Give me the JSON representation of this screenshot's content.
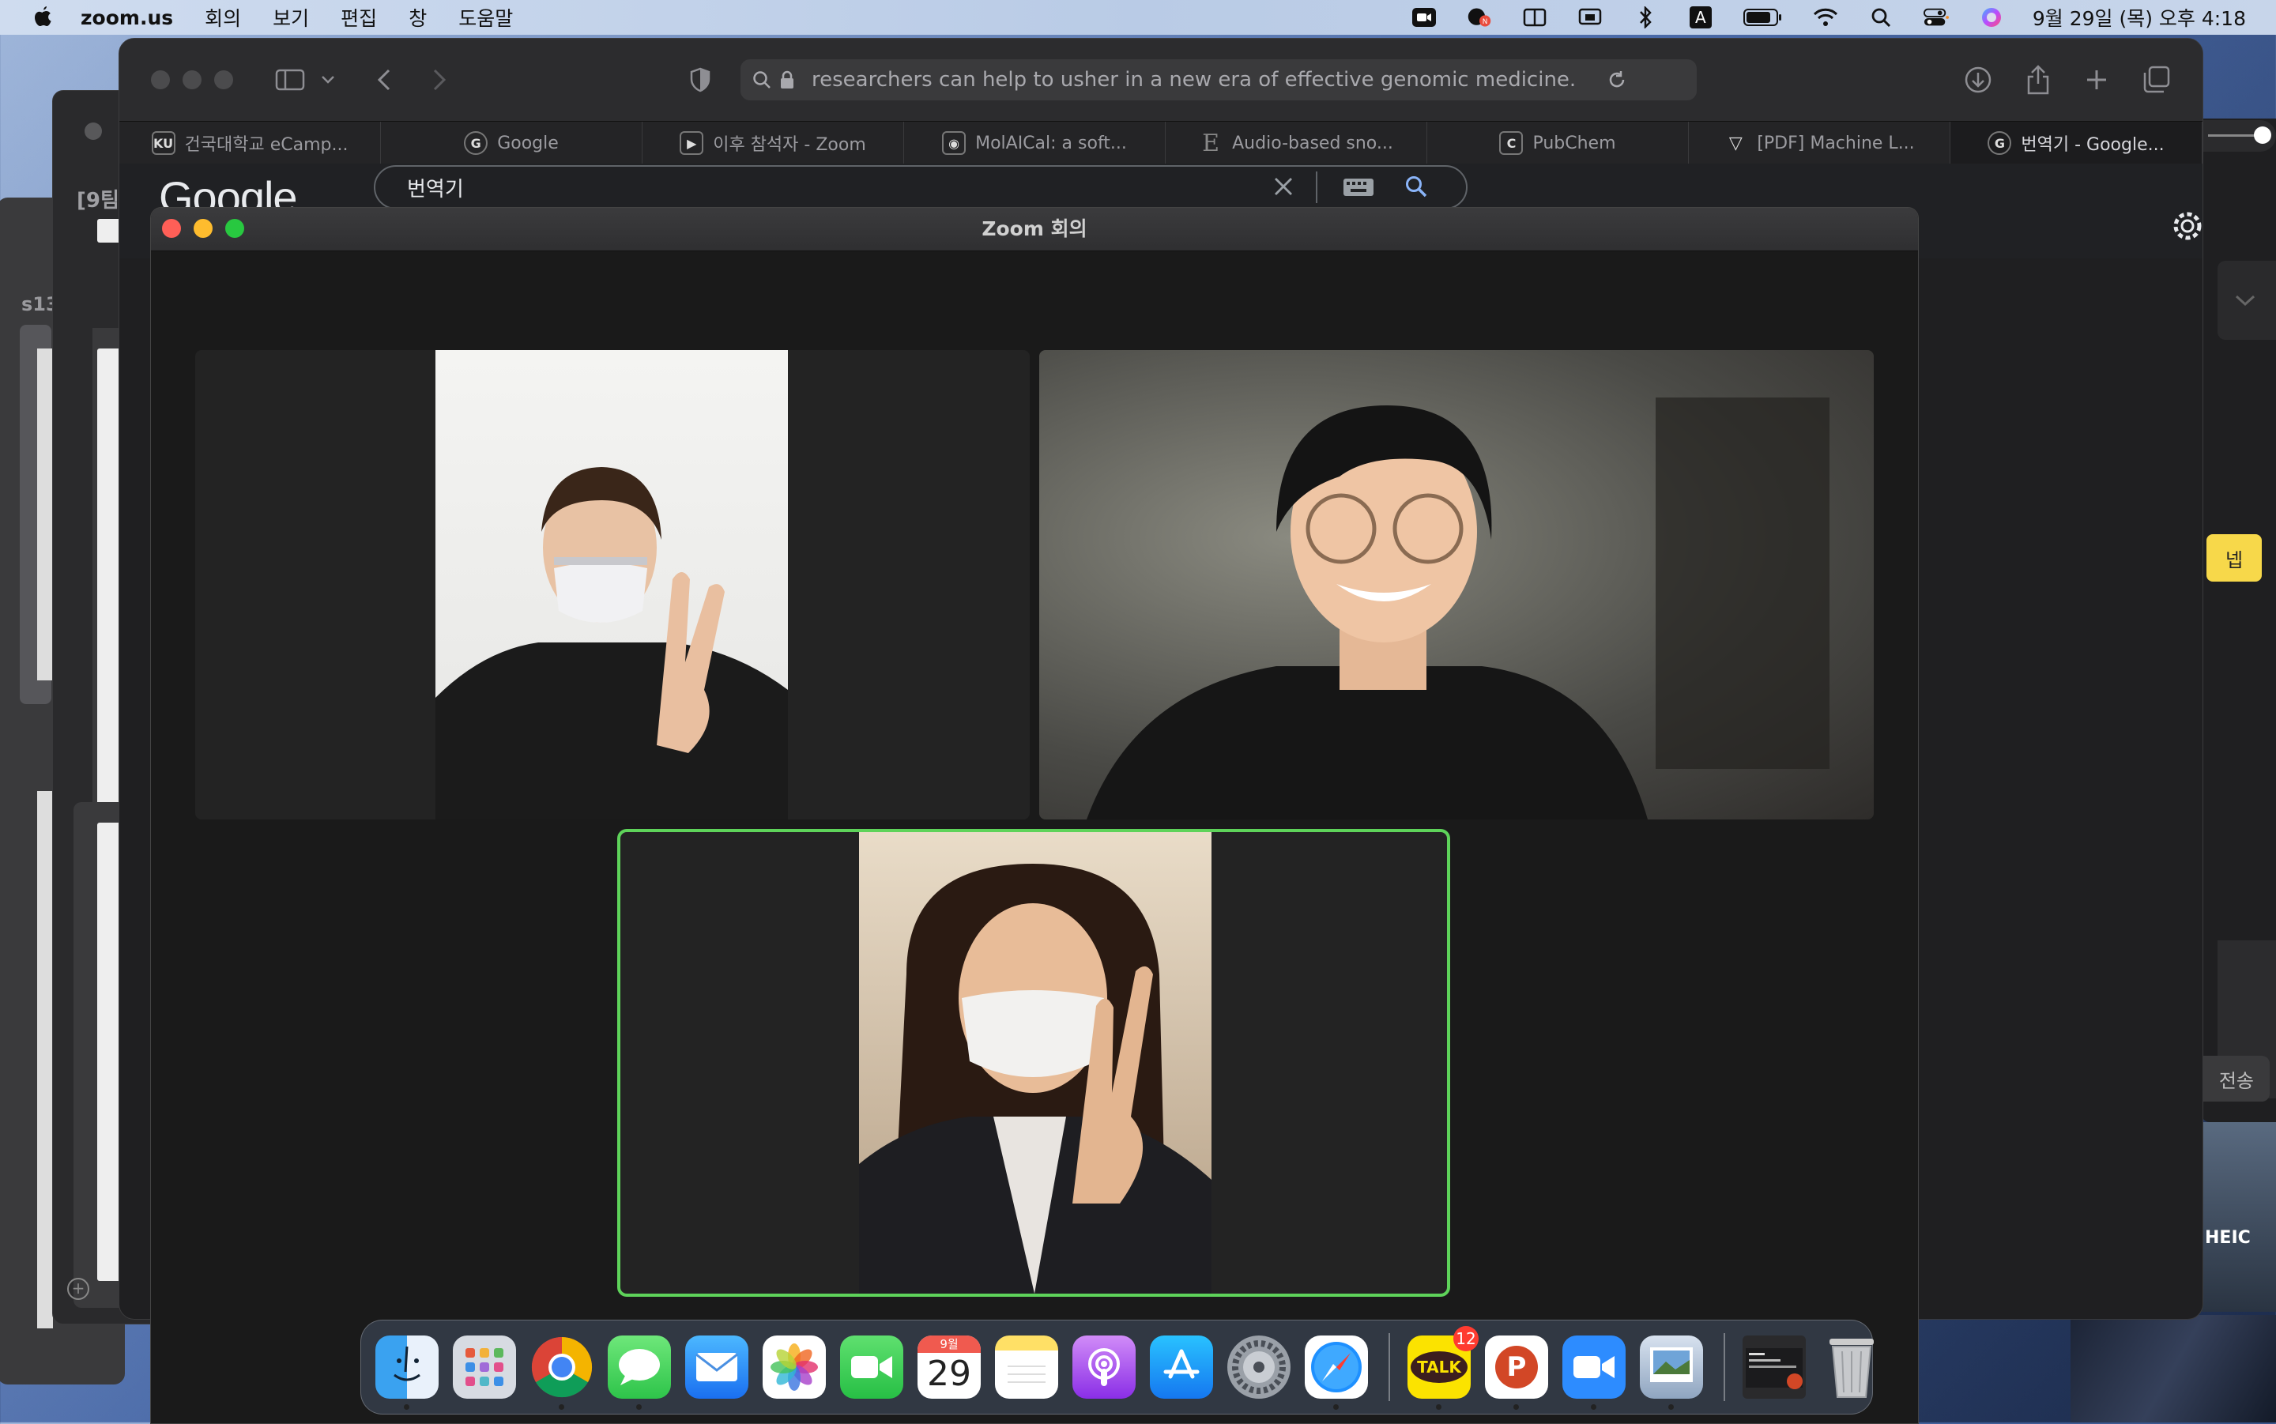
{
  "menubar": {
    "app_name": "zoom.us",
    "items": [
      "회의",
      "보기",
      "편집",
      "창",
      "도움말"
    ],
    "status_icons": [
      "zoom-status-icon",
      "chat-notification-icon",
      "split-view-icon",
      "screen-mirror-icon",
      "bluetooth-icon",
      "input-source-icon",
      "battery-icon",
      "wifi-icon",
      "spotlight-icon",
      "control-center-icon",
      "siri-icon"
    ],
    "input_source": "A",
    "clock": "9월 29일 (목) 오후 4:18"
  },
  "background_windows": {
    "label_1": "[9팀",
    "label_2": "s13",
    "sticky_note": "넵",
    "send_label": "전송",
    "file_label": "HEIC"
  },
  "safari": {
    "url": "researchers can help to usher in a new era of effective genomic medicine.",
    "tabs": [
      {
        "label": "건국대학교 eCamp...",
        "icon": "ku-favicon",
        "glyph": "KU"
      },
      {
        "label": "Google",
        "icon": "google-favicon",
        "glyph": "G"
      },
      {
        "label": "이후 참석자 - Zoom",
        "icon": "zoom-favicon",
        "glyph": "▶"
      },
      {
        "label": "MolAICal: a soft...",
        "icon": "molaical-favicon",
        "glyph": "◉"
      },
      {
        "label": "Audio-based sno...",
        "icon": "elsevier-favicon",
        "glyph": "E"
      },
      {
        "label": "PubChem",
        "icon": "pubchem-favicon",
        "glyph": "C"
      },
      {
        "label": "[PDF] Machine L...",
        "icon": "semantic-scholar-favicon",
        "glyph": "▽"
      },
      {
        "label": "번역기 - Google...",
        "icon": "google-favicon",
        "glyph": "G"
      }
    ],
    "active_tab": 7,
    "google": {
      "logo": "Google",
      "query": "번역기"
    }
  },
  "zoom": {
    "title": "Zoom 회의",
    "participants": [
      {
        "id": "participant-1",
        "speaking": false
      },
      {
        "id": "participant-2",
        "speaking": false
      },
      {
        "id": "participant-3",
        "speaking": true
      }
    ],
    "colors": {
      "speaking_border": "#5ed35a",
      "tile_bg": "#232323"
    }
  },
  "dock": {
    "apps": [
      {
        "name": "Finder",
        "icon": "finder-icon",
        "running": true
      },
      {
        "name": "Launchpad",
        "icon": "launchpad-icon",
        "running": false
      },
      {
        "name": "Chrome",
        "icon": "chrome-icon",
        "running": true
      },
      {
        "name": "Messages",
        "icon": "messages-icon",
        "running": true
      },
      {
        "name": "Mail",
        "icon": "mail-icon",
        "running": false
      },
      {
        "name": "Photos",
        "icon": "photos-icon",
        "running": false
      },
      {
        "name": "FaceTime",
        "icon": "facetime-icon",
        "running": false
      },
      {
        "name": "Calendar",
        "icon": "calendar-icon",
        "running": false,
        "month": "9월",
        "day": "29"
      },
      {
        "name": "Notes",
        "icon": "notes-icon",
        "running": false
      },
      {
        "name": "Podcasts",
        "icon": "podcasts-icon",
        "running": false
      },
      {
        "name": "App Store",
        "icon": "app-store-icon",
        "running": false
      },
      {
        "name": "System Preferences",
        "icon": "system-preferences-icon",
        "running": false
      },
      {
        "name": "Safari",
        "icon": "safari-icon",
        "running": true
      },
      {
        "name": "KakaoTalk",
        "icon": "kakaotalk-icon",
        "running": true,
        "badge": "12",
        "label": "TALK"
      },
      {
        "name": "PowerPoint",
        "icon": "powerpoint-icon",
        "running": true,
        "label": "P"
      },
      {
        "name": "Zoom",
        "icon": "zoom-icon",
        "running": true
      },
      {
        "name": "Preview",
        "icon": "preview-icon",
        "running": true
      }
    ]
  }
}
